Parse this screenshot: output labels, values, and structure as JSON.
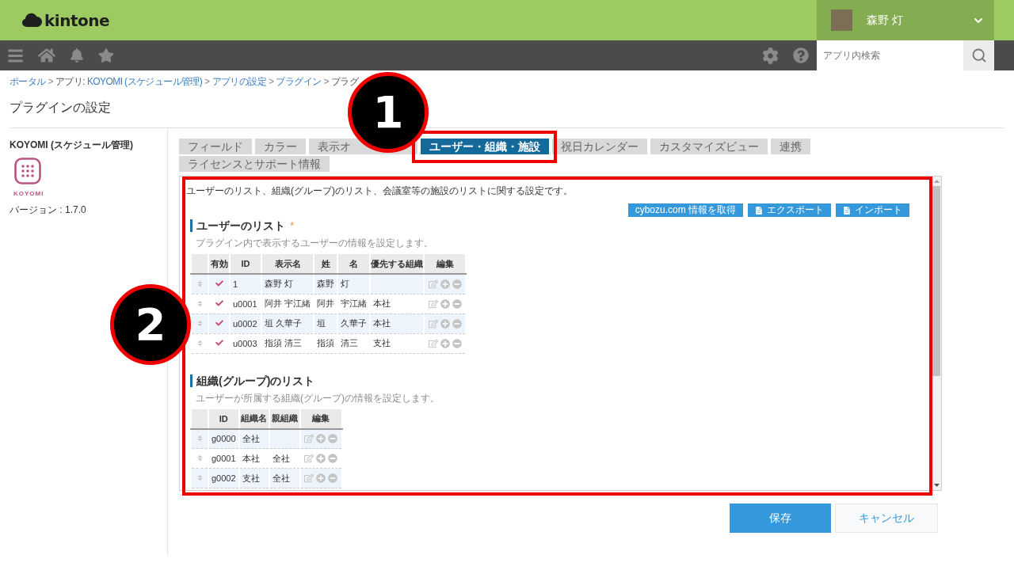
{
  "header": {
    "logo": "kintone",
    "user": {
      "name": "森野 灯"
    }
  },
  "toolbar": {
    "search": {
      "placeholder": "アプリ内検索"
    }
  },
  "breadcrumb": [
    {
      "parts": [
        {
          "kind": "link",
          "text": "ポータル"
        }
      ]
    },
    {
      "separator": ">",
      "parts": [
        {
          "kind": "text",
          "text": "アプリ:"
        },
        {
          "kind": "link",
          "text": "KOYOMI (スケジュール管理)"
        }
      ]
    },
    {
      "separator": ">",
      "parts": [
        {
          "kind": "link",
          "text": "アプリの設定"
        }
      ]
    },
    {
      "separator": ">",
      "parts": [
        {
          "kind": "link",
          "text": "プラグイン"
        }
      ]
    },
    {
      "separator": ">",
      "parts": [
        {
          "kind": "text",
          "text": "プラグ"
        }
      ]
    }
  ],
  "page_title": "プラグインの設定",
  "plugin": {
    "name": "KOYOMI (スケジュール管理)",
    "icon_label": "KOYOMI",
    "version": "バージョン : 1.7.0"
  },
  "tabs": [
    {
      "label": "フィールド",
      "selected": false,
      "highlighted": false,
      "hidden_by_callout": false
    },
    {
      "label": "カラー",
      "selected": false,
      "highlighted": false,
      "hidden_by_callout": false
    },
    {
      "label": "表示オ",
      "selected": false,
      "highlighted": false,
      "hidden_by_callout": true
    },
    {
      "label": "ユーザー・組織・施設",
      "selected": true,
      "highlighted": true,
      "hidden_by_callout": false
    },
    {
      "label": "祝日カレンダー",
      "selected": false,
      "highlighted": false,
      "hidden_by_callout": false
    },
    {
      "label": "カスタマイズビュー",
      "selected": false,
      "highlighted": false,
      "hidden_by_callout": false
    },
    {
      "label": "連携",
      "selected": false,
      "highlighted": false,
      "hidden_by_callout": false
    },
    {
      "label": "ライセンスとサポート情報",
      "selected": false,
      "highlighted": false,
      "hidden_by_callout": false
    }
  ],
  "panel": {
    "highlighted": true,
    "description": "ユーザーのリスト、組織(グループ)のリスト、会議室等の施設のリストに関する設定です。",
    "actions": [
      {
        "label": "cybozu.com 情報を取得",
        "kind": "fetch"
      },
      {
        "label": "エクスポート",
        "kind": "export"
      },
      {
        "label": "インポート",
        "kind": "import"
      }
    ],
    "sections": [
      {
        "kind": "users",
        "title": "ユーザーのリスト",
        "required_mark": "*",
        "description": "プラグイン内で表示するユーザーの情報を設定します。",
        "table": {
          "columns": [
            "有効",
            "ID",
            "表示名",
            "姓",
            "名",
            "優先する組織",
            "編集"
          ],
          "rows": [
            {
              "enabled": true,
              "id": "1",
              "display_name": "森野 灯",
              "last_name": "森野",
              "first_name": "灯"
            },
            {
              "enabled": true,
              "id": "u0001",
              "display_name": "阿井 宇江緒",
              "last_name": "阿井",
              "first_name": "宇江緒",
              "organization": "本社"
            },
            {
              "enabled": true,
              "id": "u0002",
              "display_name": "垣 久華子",
              "last_name": "垣",
              "first_name": "久華子",
              "organization": "本社"
            },
            {
              "enabled": true,
              "id": "u0003",
              "display_name": "指須 清三",
              "last_name": "指須",
              "first_name": "清三",
              "organization": "支社"
            }
          ]
        }
      },
      {
        "kind": "groups",
        "title": "組織(グループ)のリスト",
        "description": "ユーザーが所属する組織(グループ)の情報を設定します。",
        "table": {
          "columns": [
            "ID",
            "組織名",
            "親組織",
            "編集"
          ],
          "rows": [
            {
              "id": "g0000",
              "name": "全社"
            },
            {
              "id": "g0001",
              "name": "本社",
              "parent": "全社"
            },
            {
              "id": "g0002",
              "name": "支社",
              "parent": "全社"
            }
          ]
        }
      }
    ]
  },
  "buttons": [
    {
      "label": "保存",
      "kind": "primary"
    },
    {
      "label": "キャンセル",
      "kind": "secondary"
    }
  ],
  "callouts": [
    {
      "label": "1"
    },
    {
      "label": "2"
    }
  ]
}
